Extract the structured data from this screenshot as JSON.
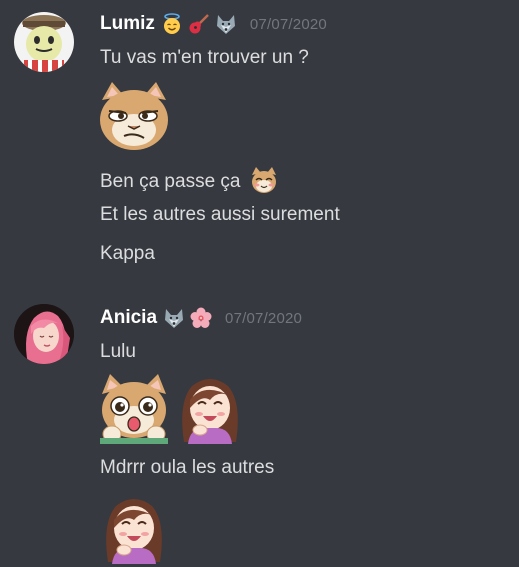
{
  "messages": [
    {
      "author": "Lumiz",
      "timestamp": "07/07/2020",
      "badges": [
        "angel-emoji-icon",
        "guitar-emoji-icon",
        "wolf-emoji-icon"
      ],
      "avatar": "ghost-character-avatar",
      "lines": [
        {
          "text": "Tu vas m'en trouver un ?"
        },
        {
          "emote": "smug-cat-emote"
        },
        {
          "text": "Ben ça passe ça",
          "inline_emote": "happy-cat-emote"
        },
        {
          "text": "Et les autres aussi surement"
        },
        {
          "text": "Kappa"
        }
      ]
    },
    {
      "author": "Anicia",
      "timestamp": "07/07/2020",
      "badges": [
        "wolf-emoji-icon",
        "hibiscus-emoji-icon"
      ],
      "avatar": "pink-hair-girl-avatar",
      "lines": [
        {
          "text": "Lulu"
        },
        {
          "emotes": [
            "surprised-cat-emote",
            "laughing-girl-emote"
          ]
        },
        {
          "text": "Mdrrr oula les autres"
        },
        {
          "emote": "laughing-girl-emote"
        }
      ]
    }
  ],
  "colors": {
    "background": "#36393f",
    "username": "#ffffff",
    "text": "#dcddde",
    "timestamp": "#72767d"
  }
}
